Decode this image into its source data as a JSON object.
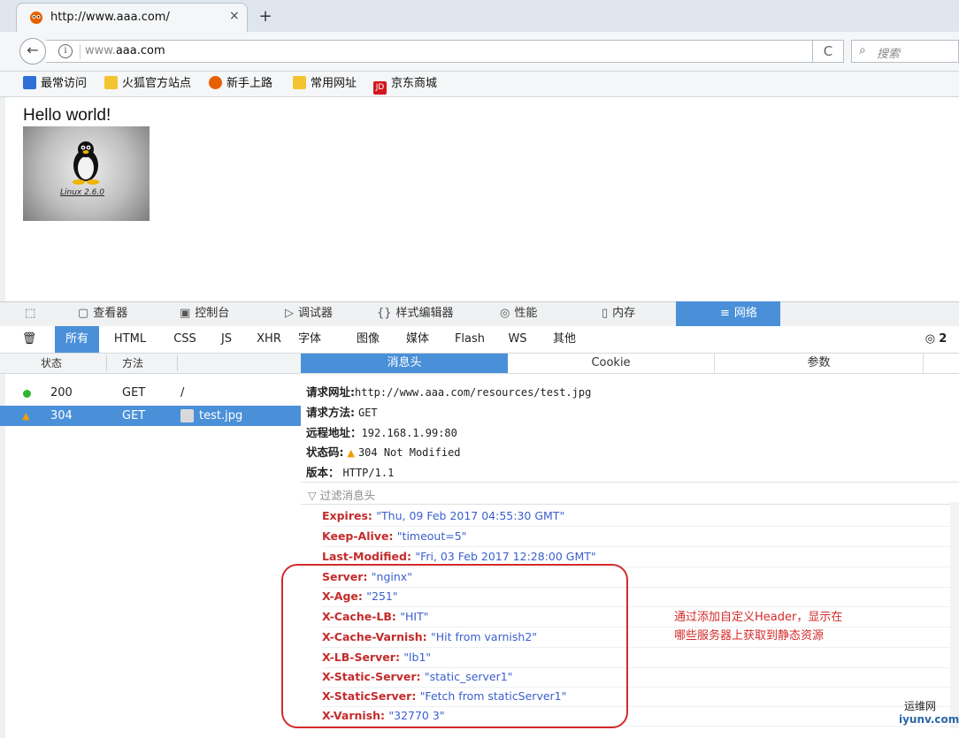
{
  "tab": {
    "title": "http://www.aaa.com/",
    "close": "×",
    "new_tab": "+"
  },
  "nav": {
    "back": "←",
    "url_prefix": "www.",
    "url_domain": "aaa.com",
    "reload": "C",
    "search_placeholder": "搜索"
  },
  "bookmarks": [
    {
      "label": "最常访问",
      "icon": "bookmark-search-icon",
      "color": "#2f6fd6"
    },
    {
      "label": "火狐官方站点",
      "icon": "folder-icon",
      "color": "#f4c430"
    },
    {
      "label": "新手上路",
      "icon": "firefox-icon",
      "color": "#e66000"
    },
    {
      "label": "常用网址",
      "icon": "folder-icon",
      "color": "#f4c430"
    },
    {
      "label": "京东商城",
      "icon": "jd-icon",
      "color": "#d3161f"
    }
  ],
  "content": {
    "heading": "Hello world!",
    "image_caption": "Linux 2.6.0"
  },
  "devtools": {
    "tabs": [
      "查看器",
      "控制台",
      "调试器",
      "样式编辑器",
      "性能",
      "内存",
      "网络"
    ],
    "filters": [
      "所有",
      "HTML",
      "CSS",
      "JS",
      "XHR",
      "字体",
      "图像",
      "媒体",
      "Flash",
      "WS",
      "其他"
    ],
    "right_count": "2",
    "list_headers": [
      "状态",
      "方法"
    ],
    "requests": [
      {
        "status": "200",
        "method": "GET",
        "file": "/",
        "indicator_color": "#2fb52f"
      },
      {
        "status": "304",
        "method": "GET",
        "file": "test.jpg",
        "indicator_color": "#f59b00"
      }
    ],
    "detail_tabs": [
      "消息头",
      "Cookie",
      "参数"
    ],
    "summary": {
      "url_label": "请求网址:",
      "url_value": "http://www.aaa.com/resources/test.jpg",
      "method_label": "请求方法:",
      "method_value": "GET",
      "remote_label": "远程地址：",
      "remote_value": "192.168.1.99:80",
      "status_label": "状态码:",
      "status_value": "304 Not Modified",
      "version_label": "版本：",
      "version_value": "HTTP/1.1"
    },
    "filter_placeholder": "过滤消息头",
    "headers": [
      {
        "name": "Expires",
        "value": "\"Thu, 09 Feb 2017 04:55:30 GMT\""
      },
      {
        "name": "Keep-Alive",
        "value": "\"timeout=5\""
      },
      {
        "name": "Last-Modified",
        "value": "\"Fri, 03 Feb 2017 12:28:00 GMT\""
      },
      {
        "name": "Server",
        "value": "\"nginx\""
      },
      {
        "name": "X-Age",
        "value": "\"251\""
      },
      {
        "name": "X-Cache-LB",
        "value": "\"HIT\""
      },
      {
        "name": "X-Cache-Varnish",
        "value": "\"Hit from varnish2\""
      },
      {
        "name": "X-LB-Server",
        "value": "\"lb1\""
      },
      {
        "name": "X-Static-Server",
        "value": "\"static_server1\""
      },
      {
        "name": "X-StaticServer",
        "value": "\"Fetch from staticServer1\""
      },
      {
        "name": "X-Varnish",
        "value": "\"32770 3\""
      }
    ]
  },
  "annotation": {
    "line1": "通过添加自定义Header，显示在",
    "line2": "哪些服务器上获取到静态资源"
  },
  "watermark": {
    "line1": "运维网",
    "line2": "iyunv.com"
  }
}
